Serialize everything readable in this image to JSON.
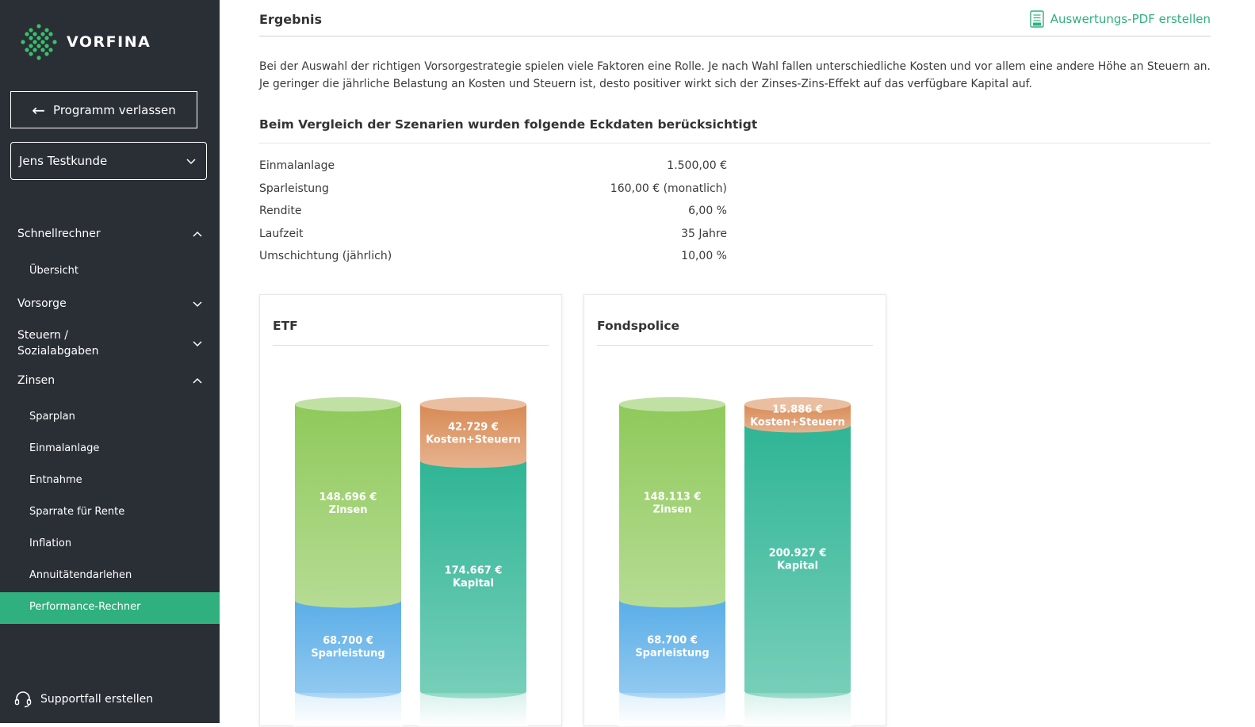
{
  "brand": {
    "name": "VORFINA",
    "accent": "#2fb07e",
    "sidebar_bg": "#2a2e35"
  },
  "sidebar": {
    "exit_label": "Programm verlassen",
    "client": "Jens Testkunde",
    "sections": [
      {
        "label": "Schnellrechner",
        "expanded": true
      },
      {
        "label": "Vorsorge",
        "expanded": false
      },
      {
        "label_line1": "Steuern /",
        "label_line2": "Sozialabgaben",
        "expanded": false
      },
      {
        "label": "Zinsen",
        "expanded": true
      }
    ],
    "schnellrechner_items": [
      "Übersicht"
    ],
    "zinsen_items": [
      "Sparplan",
      "Einmalanlage",
      "Entnahme",
      "Sparrate für Rente",
      "Inflation",
      "Annuitätendarlehen",
      "Performance-Rechner"
    ],
    "active_item": "Performance-Rechner",
    "support_label": "Supportfall erstellen"
  },
  "main": {
    "title": "Ergebnis",
    "pdf_label": "Auswertungs-PDF erstellen",
    "intro": "Bei der Auswahl der richtigen Vorsorgestrategie spielen viele Faktoren eine Rolle. Je nach Wahl fallen unterschiedliche Kosten und vor allem eine andere Höhe an Steuern an. Je geringer die jährliche Belastung an Kosten und Steuern ist, desto positiver wirkt sich der Zinses-Zins-Effekt auf das verfügbare Kapital auf.",
    "params_title": "Beim Vergleich der Szenarien wurden folgende Eckdaten berücksichtigt",
    "params": [
      {
        "label": "Einmalanlage",
        "value": "1.500,00 €"
      },
      {
        "label": "Sparleistung",
        "value": "160,00 € (monatlich)"
      },
      {
        "label": "Rendite",
        "value": "6,00 %"
      },
      {
        "label": "Laufzeit",
        "value": "35 Jahre"
      },
      {
        "label": "Umschichtung (jährlich)",
        "value": "10,00 %"
      }
    ]
  },
  "chart_data": [
    {
      "type": "bar",
      "title": "ETF",
      "stacks": [
        {
          "segments": [
            {
              "name": "Sparleistung",
              "value": 68700,
              "label": "68.700 €",
              "color": "#5aaee8"
            },
            {
              "name": "Zinsen",
              "value": 148696,
              "label": "148.696 €",
              "color": "#8fc95a"
            }
          ]
        },
        {
          "segments": [
            {
              "name": "Kapital",
              "value": 174667,
              "label": "174.667 €",
              "color": "#2fb595"
            },
            {
              "name": "Kosten+Steuern",
              "value": 42729,
              "label": "42.729 €",
              "color": "#d88a54"
            }
          ]
        }
      ]
    },
    {
      "type": "bar",
      "title": "Fondspolice",
      "stacks": [
        {
          "segments": [
            {
              "name": "Sparleistung",
              "value": 68700,
              "label": "68.700 €",
              "color": "#5aaee8"
            },
            {
              "name": "Zinsen",
              "value": 148113,
              "label": "148.113 €",
              "color": "#8fc95a"
            }
          ]
        },
        {
          "segments": [
            {
              "name": "Kapital",
              "value": 200927,
              "label": "200.927 €",
              "color": "#2fb595"
            },
            {
              "name": "Kosten+Steuern",
              "value": 15886,
              "label": "15.886 €",
              "color": "#d88a54"
            }
          ]
        }
      ]
    }
  ]
}
